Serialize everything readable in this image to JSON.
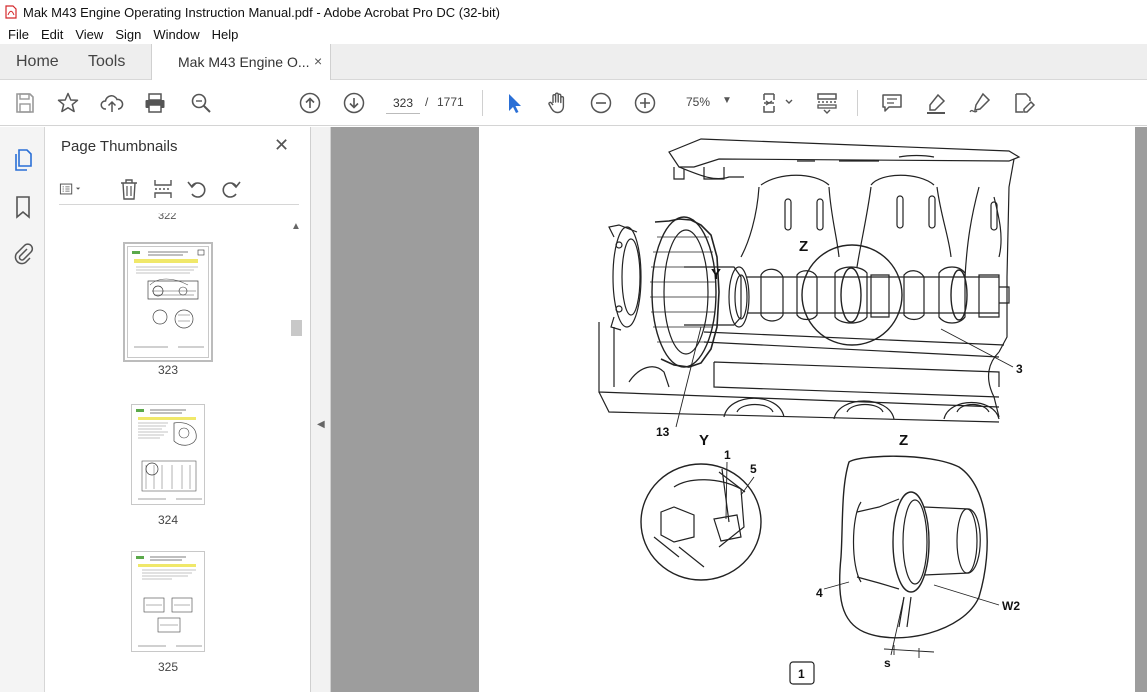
{
  "window": {
    "title": "Mak M43 Engine Operating Instruction Manual.pdf - Adobe Acrobat Pro DC (32-bit)"
  },
  "menu": [
    "File",
    "Edit",
    "View",
    "Sign",
    "Window",
    "Help"
  ],
  "tabs": {
    "home": "Home",
    "tools": "Tools",
    "document": "Mak M43 Engine O...",
    "close": "×"
  },
  "toolbar": {
    "current_page": "323",
    "separator": "/",
    "total_pages": "1771",
    "zoom": "75%",
    "icons": [
      "save-icon",
      "bookmark-star-icon",
      "upload-icon",
      "print-icon",
      "find-icon",
      "prev-page-icon",
      "next-page-icon",
      "select-arrow-icon",
      "hand-icon",
      "zoom-out-icon",
      "zoom-in-icon",
      "fit-page-icon",
      "scroll-mode-icon",
      "comment-icon",
      "highlight-icon",
      "sign-icon",
      "edit-pdf-icon"
    ]
  },
  "left_rail": {
    "icons": [
      "page-thumbnails-icon",
      "bookmarks-icon",
      "attachments-icon"
    ]
  },
  "thumbnails": {
    "title": "Page Thumbnails",
    "close": "✕",
    "prev_page_label": "322",
    "pages": [
      {
        "num": "323",
        "selected": true
      },
      {
        "num": "324",
        "selected": false
      },
      {
        "num": "325",
        "selected": false
      }
    ]
  },
  "document": {
    "labels": {
      "z_top": "Z",
      "y_top": "Y",
      "callout_3": "3",
      "callout_13": "13",
      "detail_y": "Y",
      "detail_z": "Z",
      "callout_1": "1",
      "callout_5": "5",
      "callout_4": "4",
      "callout_w2": "W2",
      "callout_s": "s",
      "figure_num": "1"
    }
  },
  "colors": {
    "doc_background": "#9d9d9d",
    "accent_blue": "#2a6fd6",
    "pdf_red": "#d4282b"
  }
}
